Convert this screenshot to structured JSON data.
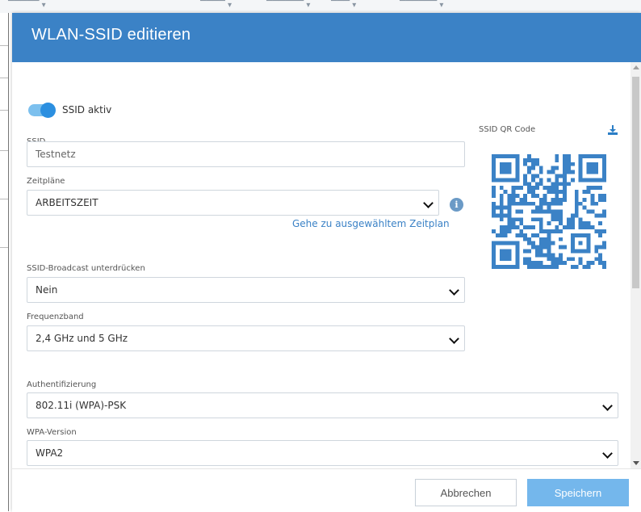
{
  "modal": {
    "title": "WLAN-SSID editieren"
  },
  "form": {
    "ssid_active_label": "SSID aktiv",
    "ssid_active": true,
    "ssid_label": "SSID",
    "ssid_value": "Testnetz",
    "schedules_label": "Zeitpläne",
    "schedules_value": "ARBEITSZEIT",
    "schedule_link": "Gehe zu ausgewähltem Zeitplan",
    "broadcast_label": "SSID-Broadcast unterdrücken",
    "broadcast_value": "Nein",
    "band_label": "Frequenzband",
    "band_value": "2,4 GHz und 5 GHz",
    "auth_label": "Authentifizierung",
    "auth_value": "802.11i (WPA)-PSK",
    "wpa_label": "WPA-Version",
    "wpa_value": "WPA2",
    "qr_label": "SSID QR Code"
  },
  "footer": {
    "cancel_label": "Abbrechen",
    "save_label": "Speichern"
  },
  "colors": {
    "accent": "#3b82c6",
    "save_button": "#74b7ec",
    "toggle_on": "#2b8fe0"
  },
  "icons": {
    "info": "info-icon",
    "download": "download-icon",
    "chevron": "chevron-down-icon"
  }
}
